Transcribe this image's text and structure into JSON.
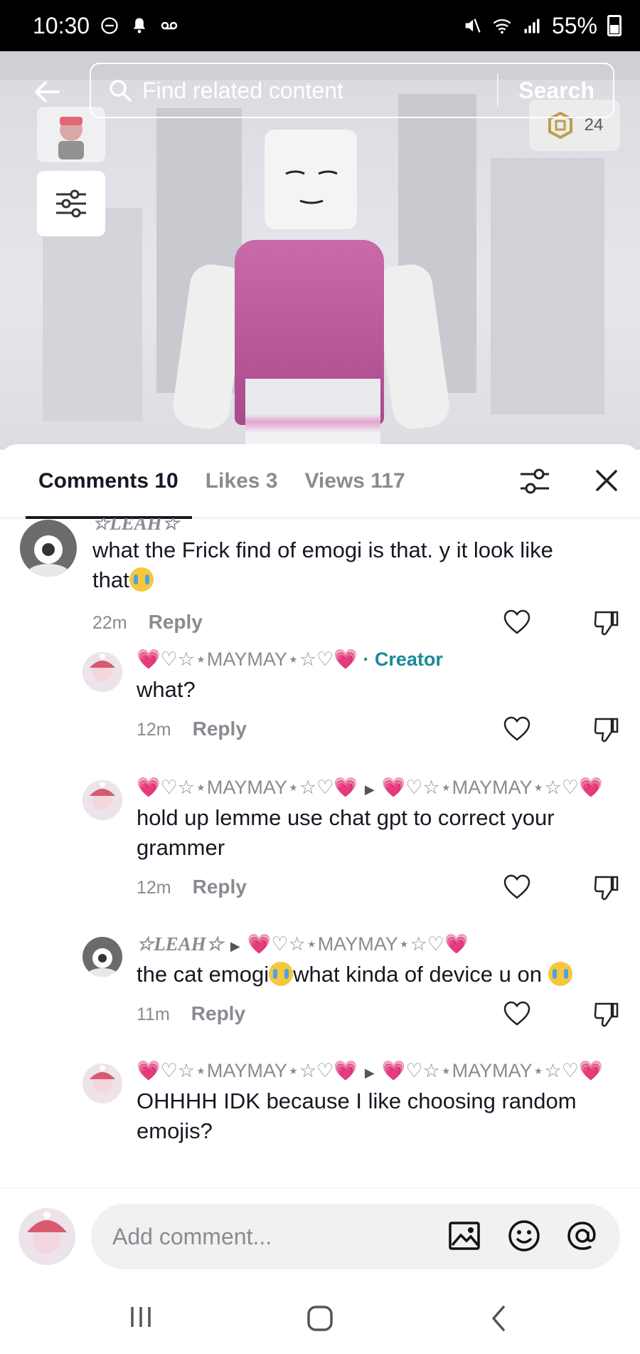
{
  "status_bar": {
    "time": "10:30",
    "battery": "55%"
  },
  "video": {
    "search_placeholder": "Find related content",
    "search_button": "Search",
    "robux_count": "24"
  },
  "tabs": {
    "comments": "Comments 10",
    "likes": "Likes 3",
    "views": "Views 117"
  },
  "comments": [
    {
      "author": "☆LEAH☆",
      "text": "what the Frick find of emogi is that. y it look like that",
      "time": "22m",
      "reply_label": "Reply"
    },
    {
      "author": "💗♡☆⋆MAYMAY⋆☆♡💗",
      "author_badge": "· Creator",
      "text": "what?",
      "time": "12m",
      "reply_label": "Reply"
    },
    {
      "author": "💗♡☆⋆MAYMAY⋆☆♡💗",
      "reply_to": "💗♡☆⋆MAYMAY⋆☆♡💗",
      "text": "hold up lemme use chat gpt to correct your grammer",
      "time": "12m",
      "reply_label": "Reply"
    },
    {
      "author": "☆LEAH☆",
      "reply_to": "💗♡☆⋆MAYMAY⋆☆♡💗",
      "text_part1": "the cat emogi",
      "text_part2": "what kinda of device u on",
      "time": "11m",
      "reply_label": "Reply"
    },
    {
      "author": "💗♡☆⋆MAYMAY⋆☆♡💗",
      "reply_to": "💗♡☆⋆MAYMAY⋆☆♡💗",
      "text": "OHHHH IDK because I like choosing random emojis?"
    }
  ],
  "input": {
    "placeholder": "Add comment..."
  },
  "colors": {
    "creator_badge": "#1c8a97",
    "text_primary": "#161823",
    "text_secondary": "#8a8b91"
  }
}
